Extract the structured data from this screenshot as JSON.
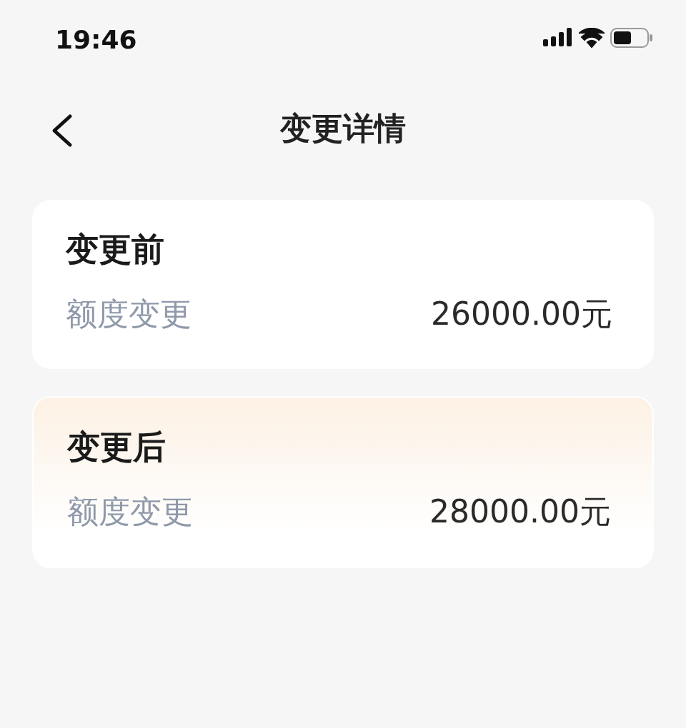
{
  "status_bar": {
    "time": "19:46"
  },
  "nav": {
    "title": "变更详情"
  },
  "cards": [
    {
      "title": "变更前",
      "highlighted": false,
      "rows": [
        {
          "label": "额度变更",
          "value": "26000.00元"
        }
      ]
    },
    {
      "title": "变更后",
      "highlighted": true,
      "rows": [
        {
          "label": "额度变更",
          "value": "28000.00元"
        }
      ]
    }
  ]
}
